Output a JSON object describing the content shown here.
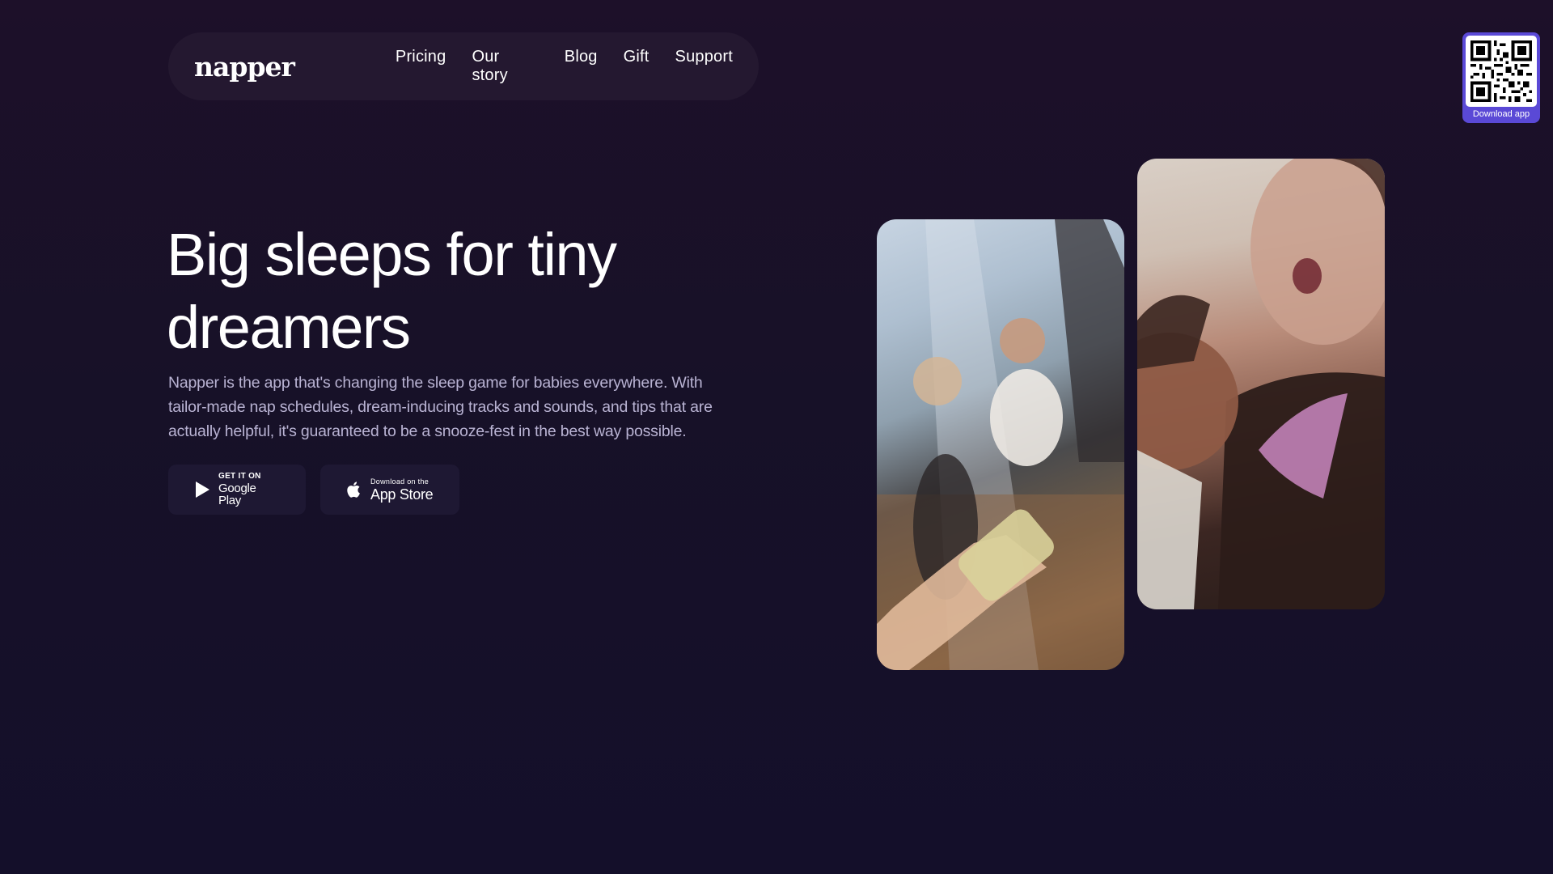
{
  "nav": {
    "logo": "napper",
    "links": [
      "Pricing",
      "Our story",
      "Blog",
      "Gift",
      "Support"
    ]
  },
  "qr": {
    "caption": "Download app"
  },
  "hero": {
    "title_line1": "Big sleeps for tiny",
    "title_line2": "dreamers",
    "description": "Napper is the app that's changing the sleep game for babies everywhere. With tailor-made nap schedules, dream-inducing tracks and sounds, and tips that are actually helpful, it's guaranteed to be a snooze-fest in the best way possible."
  },
  "stores": {
    "google_play": {
      "small": "GET IT ON",
      "big": "Google Play",
      "icon": "play-store-icon"
    },
    "app_store": {
      "small": "Download on the",
      "big": "App Store",
      "icon": "apple-icon"
    }
  },
  "colors": {
    "background": "#171128",
    "nav_pill": "#201a30",
    "description_text": "#b9b3d3",
    "qr_badge": "#5a49d6",
    "store_button": "#1e1833"
  }
}
